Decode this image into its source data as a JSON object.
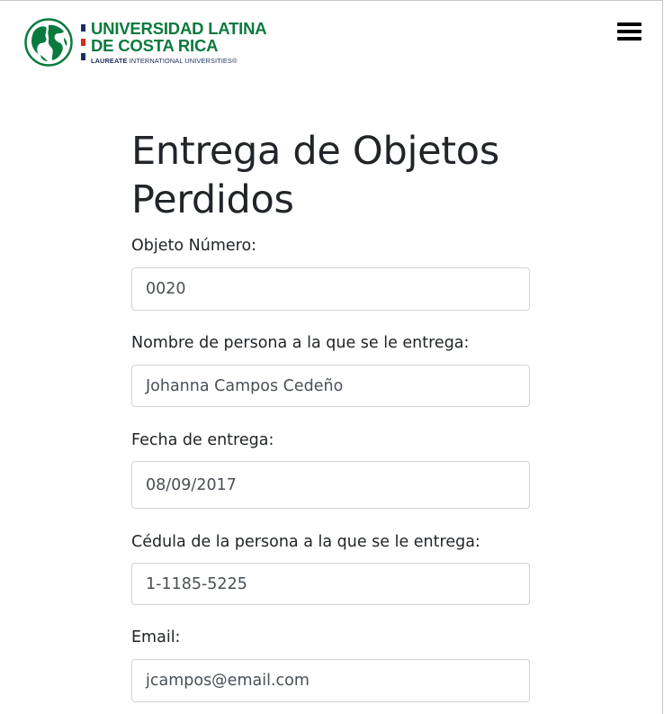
{
  "header": {
    "logo": {
      "line1": "UNIVERSIDAD LATINA",
      "line2": "DE COSTA RICA",
      "line3_bold": "LAUREATE",
      "line3_rest": " INTERNATIONAL UNIVERSITIES®"
    },
    "menu_icon": "hamburger-icon"
  },
  "page": {
    "title": "Entrega de Objetos Perdidos"
  },
  "form": {
    "objeto_numero": {
      "label": "Objeto Número:",
      "value": "0020"
    },
    "nombre": {
      "label": "Nombre de persona a la que se le entrega:",
      "value": "Johanna Campos Cedeño"
    },
    "fecha": {
      "label": "Fecha de entrega:",
      "value": "08/09/2017"
    },
    "cedula": {
      "label": "Cédula de la persona a la que se le entrega:",
      "value": "1-1185-5225"
    },
    "email": {
      "label": "Email:",
      "value": "jcampos@email.com"
    }
  },
  "colors": {
    "brand_green": "#0b7a3e",
    "brand_navy": "#1f2e5e",
    "flag_red": "#d52b1e"
  }
}
